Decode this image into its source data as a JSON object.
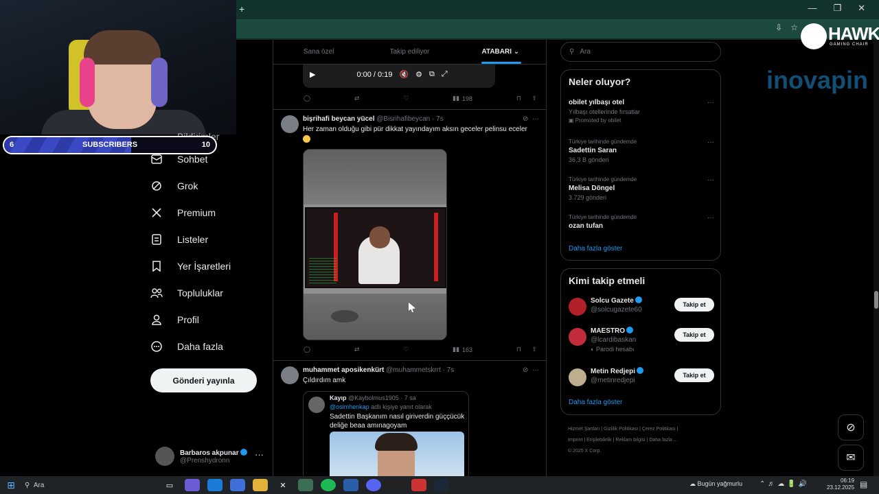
{
  "overlay": {
    "subscribers": {
      "current": "6",
      "label": "SUBSCRIBERS",
      "goal": "10",
      "progress": 0.6
    },
    "hawk": {
      "title": "HAWK",
      "subtitle": "GAMING CHAIR"
    },
    "inovapin": "inovapin"
  },
  "sidebar": {
    "items": [
      {
        "label": "Bildirimler"
      },
      {
        "label": "Sohbet"
      },
      {
        "label": "Grok"
      },
      {
        "label": "Premium"
      },
      {
        "label": "Listeler"
      },
      {
        "label": "Yer İşaretleri"
      },
      {
        "label": "Topluluklar"
      },
      {
        "label": "Profil"
      },
      {
        "label": "Daha fazla"
      }
    ],
    "post_label": "Gönderi yayınla",
    "account": {
      "name": "Barbaros akpunar",
      "handle": "@Prenshydronn"
    }
  },
  "main": {
    "tabs": [
      {
        "label": "Sana özel"
      },
      {
        "label": "Takip ediliyor"
      },
      {
        "label": "ATABARI"
      }
    ],
    "video": {
      "time": "0:00 / 0:19"
    },
    "tweet0": {
      "views": "198"
    },
    "tweet1": {
      "name": "bişrihafi beycan yücel",
      "meta": "@Bisrihafibeycan · 7s",
      "text": "Her zaman olduğu gibi pür dikkat yayındayım aksın geceler pelinsu eceler",
      "views": "163"
    },
    "tweet2": {
      "name": "muhammet aposikenkürt",
      "meta": "@muhammetskrrt · 7s",
      "text": "Çıldırdım amk",
      "quote": {
        "name": "Kayıp",
        "meta": "@Kaybolmus1905 · 7 sa",
        "reply_link": "@osimhenkap",
        "reply_suffix": "adlı kişiye yanıt olarak",
        "text": "Sadettin Başkanım nasıl giriverdin güççücük deliğe beaa amınagoyam"
      }
    }
  },
  "right": {
    "search_placeholder": "Ara",
    "trends": {
      "title": "Neler oluyor?",
      "items": [
        {
          "name": "obilet yılbaşı otel",
          "sub": "Yılbaşı otellerinde fırsatlar",
          "promo": "Promoted by obilet"
        },
        {
          "top": "Türkiye tarihinde gündemde",
          "name": "Sadettin Saran",
          "sub": "36,3 B gönderi"
        },
        {
          "top": "Türkiye tarihinde gündemde",
          "name": "Melisa Döngel",
          "sub": "3.729 gönderi"
        },
        {
          "top": "Türkiye tarihinde gündemde",
          "name": "ozan tufan"
        }
      ],
      "show_more": "Daha fazla göster"
    },
    "follow": {
      "title": "Kimi takip etmeli",
      "items": [
        {
          "name": "Solcu Gazete",
          "handle": "@solcugazete60",
          "button": "Takip et",
          "color": "#b3202a"
        },
        {
          "name": "MAESTRO",
          "handle": "@lcardibaskan",
          "parody": "Parodi hesabı",
          "button": "Takip et",
          "color": "#c22b3a"
        },
        {
          "name": "Metin Redjepi",
          "handle": "@metinredjepi",
          "button": "Takip et",
          "color": "#bcae8f"
        }
      ],
      "show_more": "Daha fazla göster"
    },
    "footer": {
      "links": [
        "Hizmet Şartları",
        "Gizlilik Politikası",
        "Çerez Politikası",
        "Imprint",
        "Erişilebilirlik",
        "Reklam bilgisi",
        "Daha fazla ..."
      ],
      "copyright": "© 2025 X Corp."
    }
  },
  "taskbar": {
    "search": "Ara",
    "weather": "Bugün yağmurlu",
    "time": "06:19",
    "date": "23.12.2025"
  }
}
